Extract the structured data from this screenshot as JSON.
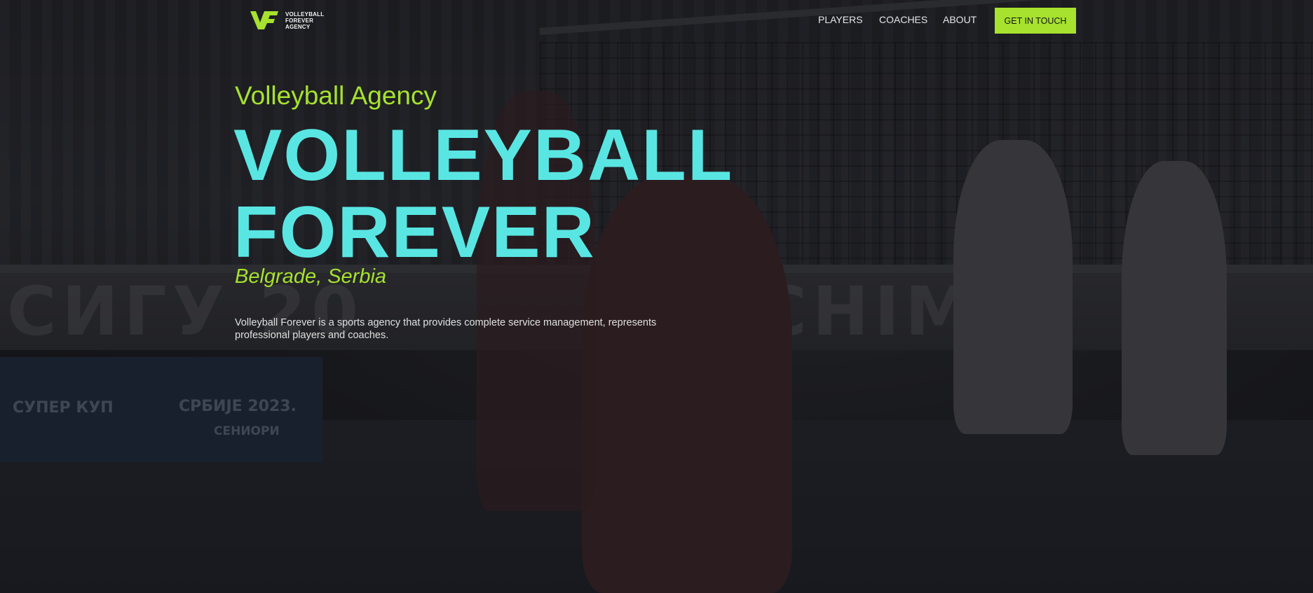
{
  "brand": {
    "logo_lines": [
      "VOLLEYBALL",
      "FOREVER",
      "AGENCY"
    ],
    "accent_color": "#a6e22e",
    "headline_color": "#59e6e3"
  },
  "nav": {
    "items": [
      {
        "label": "PLAYERS"
      },
      {
        "label": "COACHES"
      },
      {
        "label": "ABOUT"
      }
    ],
    "cta_label": "GET IN TOUCH"
  },
  "hero": {
    "eyebrow": "Volleyball Agency",
    "headline_line1": "VOLLEYBALL",
    "headline_line2": "FOREVER",
    "location": "Belgrade, Serbia",
    "description": "Volleyball Forever is a sports agency that provides complete service management, represents professional players and coaches."
  },
  "background": {
    "board_text": "СИГУ 20",
    "board_text_right": "CHIMP",
    "banner_line1": "СУПЕР КУП",
    "banner_line2": "СРБИЈЕ 2023.",
    "banner_line3": "СЕНИОРИ"
  }
}
